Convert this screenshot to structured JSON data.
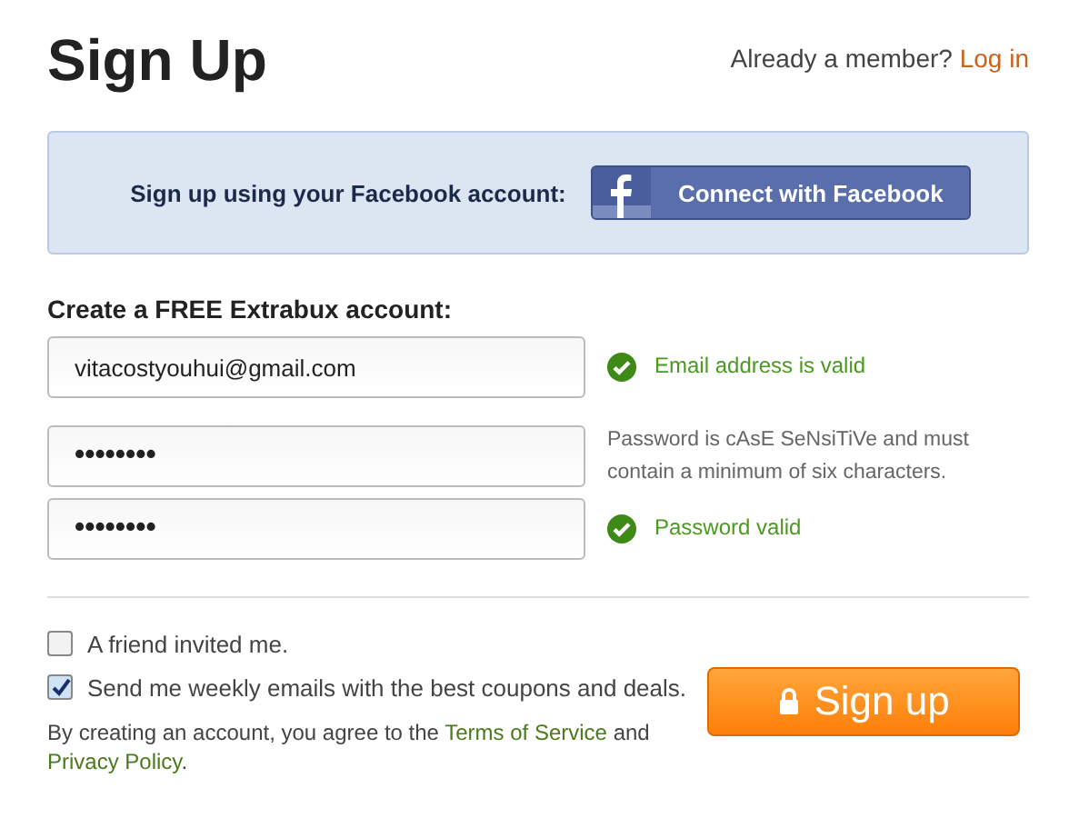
{
  "header": {
    "title": "Sign Up",
    "member_prompt": "Already a member?",
    "login_link": "Log in"
  },
  "facebook": {
    "prompt": "Sign up using your Facebook account:",
    "button": "Connect with Facebook"
  },
  "form": {
    "heading": "Create a FREE Extrabux account:",
    "fields": [
      {
        "kind": "email",
        "value": "vitacostyouhui@gmail.com",
        "message": {
          "kind": "valid",
          "text": "Email address is valid"
        }
      },
      {
        "kind": "password",
        "value": "••••••••",
        "message": {
          "kind": "hint",
          "text": "Password is cAsE SeNsiTiVe and must contain a minimum of six characters."
        }
      },
      {
        "kind": "password",
        "value": "••••••••",
        "message": {
          "kind": "valid",
          "text": "Password valid"
        }
      }
    ]
  },
  "options": [
    {
      "label": "A friend invited me.",
      "checked": false
    },
    {
      "label": "Send me weekly emails with the best coupons and deals.",
      "checked": true
    }
  ],
  "terms": {
    "before": "By creating an account, you agree to the",
    "terms_link": "Terms of Service",
    "between": "and",
    "privacy_link": "Privacy Policy",
    "after": "."
  },
  "submit": {
    "label": "Sign up"
  }
}
